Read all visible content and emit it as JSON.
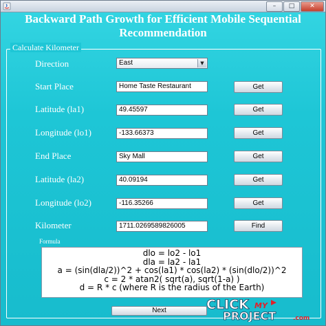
{
  "window": {
    "title": "Backward Path Growth for Efficient Mobile Sequential Recommendation",
    "controls": {
      "minimize": "–",
      "maximize": "□",
      "close": "✕"
    }
  },
  "panel": {
    "title": "Calculate Kilometer"
  },
  "direction": {
    "label": "Direction",
    "selected": "East",
    "arrow": "▼"
  },
  "start_place": {
    "label": "Start Place",
    "value": "Home Taste Restaurant",
    "button": "Get"
  },
  "latitude1": {
    "label": "Latitude (la1)",
    "value": "49.45597",
    "button": "Get"
  },
  "longitude1": {
    "label": "Longitude (lo1)",
    "value": "-133.66373",
    "button": "Get"
  },
  "end_place": {
    "label": "End Place",
    "value": "Sky Mall",
    "button": "Get"
  },
  "latitude2": {
    "label": "Latitude (la2)",
    "value": "40.09194",
    "button": "Get"
  },
  "longitude2": {
    "label": "Longitude (lo2)",
    "value": "-116.35266",
    "button": "Get"
  },
  "kilometer": {
    "label": "Kilometer",
    "value": "1711.0269589826005",
    "button": "Find"
  },
  "formula": {
    "title": "Formula",
    "lines": [
      "dlo = lo2 - lo1",
      "dla = la2 - la1",
      "a = (sin(dla/2))^2 + cos(la1) * cos(la2) * (sin(dlo/2))^2",
      "c = 2 * atan2( sqrt(a), sqrt(1-a) )",
      "d = R * c (where R is the radius of the Earth)"
    ]
  },
  "next_button": "Next",
  "watermark": {
    "word1": "CLICK",
    "word2": "MY",
    "word3": "PROJECT",
    "suffix": ".com"
  },
  "colors": {
    "background": "#1ec6d6",
    "text": "#ffffff",
    "watermark_accent": "#e0202a"
  }
}
